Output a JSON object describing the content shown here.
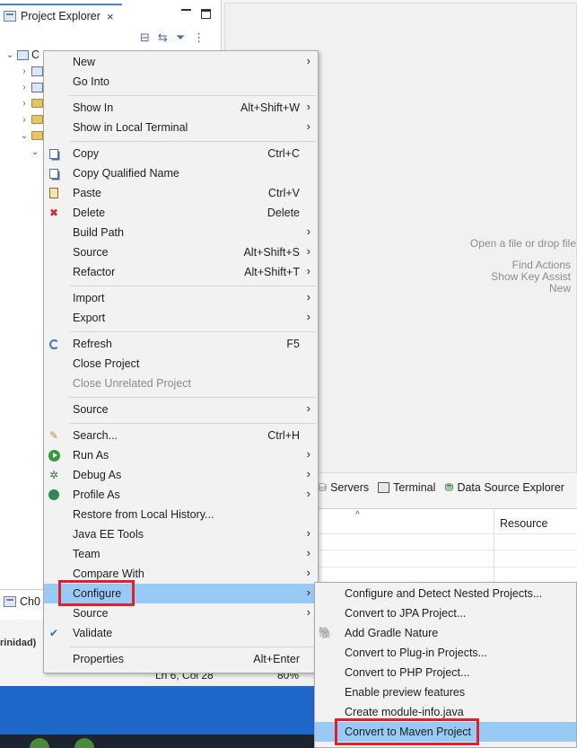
{
  "explorer": {
    "tab_label": "Project Explorer",
    "close_glyph": "×",
    "project_label": "C",
    "bottom_tab_label": "Ch0",
    "trinidad_label": "rinidad)"
  },
  "editor_hints": {
    "line1": "Open a file or drop file",
    "line2": "Find Actions",
    "line3": "Show Key Assist",
    "line4": "New"
  },
  "bottom_views": {
    "servers": "Servers",
    "terminal": "Terminal",
    "data_source": "Data Source Explorer",
    "resource_col": "Resource"
  },
  "status": {
    "position": "Ln 6, Col 28",
    "zoom": "80%"
  },
  "context_menu": {
    "items": [
      {
        "label": "New",
        "shortcut": "",
        "submenu": true
      },
      {
        "label": "Go Into",
        "shortcut": ""
      },
      {
        "label": "Show In",
        "shortcut": "Alt+Shift+W",
        "submenu": true
      },
      {
        "label": "Show in Local Terminal",
        "shortcut": "",
        "submenu": true
      },
      {
        "label": "Copy",
        "shortcut": "Ctrl+C",
        "icon": "copy-icon"
      },
      {
        "label": "Copy Qualified Name",
        "shortcut": "",
        "icon": "copy-qualified-icon"
      },
      {
        "label": "Paste",
        "shortcut": "Ctrl+V",
        "icon": "paste-icon"
      },
      {
        "label": "Delete",
        "shortcut": "Delete",
        "icon": "delete-icon"
      },
      {
        "label": "Build Path",
        "shortcut": "",
        "submenu": true
      },
      {
        "label": "Source",
        "shortcut": "Alt+Shift+S",
        "submenu": true
      },
      {
        "label": "Refactor",
        "shortcut": "Alt+Shift+T",
        "submenu": true
      },
      {
        "label": "Import",
        "shortcut": "",
        "submenu": true
      },
      {
        "label": "Export",
        "shortcut": "",
        "submenu": true
      },
      {
        "label": "Refresh",
        "shortcut": "F5",
        "icon": "refresh-icon"
      },
      {
        "label": "Close Project",
        "shortcut": ""
      },
      {
        "label": "Close Unrelated Project",
        "shortcut": "",
        "disabled": true
      },
      {
        "label": "Source",
        "shortcut": "",
        "submenu": true
      },
      {
        "label": "Search...",
        "shortcut": "Ctrl+H",
        "icon": "search-icon"
      },
      {
        "label": "Run As",
        "shortcut": "",
        "submenu": true,
        "icon": "run-icon"
      },
      {
        "label": "Debug As",
        "shortcut": "",
        "submenu": true,
        "icon": "debug-icon"
      },
      {
        "label": "Profile As",
        "shortcut": "",
        "submenu": true,
        "icon": "profile-icon"
      },
      {
        "label": "Restore from Local History...",
        "shortcut": ""
      },
      {
        "label": "Java EE Tools",
        "shortcut": "",
        "submenu": true
      },
      {
        "label": "Team",
        "shortcut": "",
        "submenu": true
      },
      {
        "label": "Compare With",
        "shortcut": "",
        "submenu": true
      },
      {
        "label": "Configure",
        "shortcut": "",
        "submenu": true,
        "selected": true
      },
      {
        "label": "Source",
        "shortcut": "",
        "submenu": true
      },
      {
        "label": "Validate",
        "shortcut": "",
        "icon": "validate-check-icon"
      },
      {
        "label": "Properties",
        "shortcut": "Alt+Enter"
      }
    ],
    "arrow_glyph": "›"
  },
  "configure_submenu": {
    "items": [
      {
        "label": "Configure and Detect Nested Projects..."
      },
      {
        "label": "Convert to JPA Project..."
      },
      {
        "label": "Add Gradle Nature",
        "icon": "gradle-elephant-icon"
      },
      {
        "label": "Convert to Plug-in Projects..."
      },
      {
        "label": "Convert to PHP Project..."
      },
      {
        "label": "Enable preview features"
      },
      {
        "label": "Create module-info.java"
      },
      {
        "label": "Convert to Maven Project",
        "selected": true
      }
    ]
  },
  "colors": {
    "selection": "#99c9f5",
    "highlight_box": "#e0202a",
    "taskbar": "#1f66c9"
  }
}
